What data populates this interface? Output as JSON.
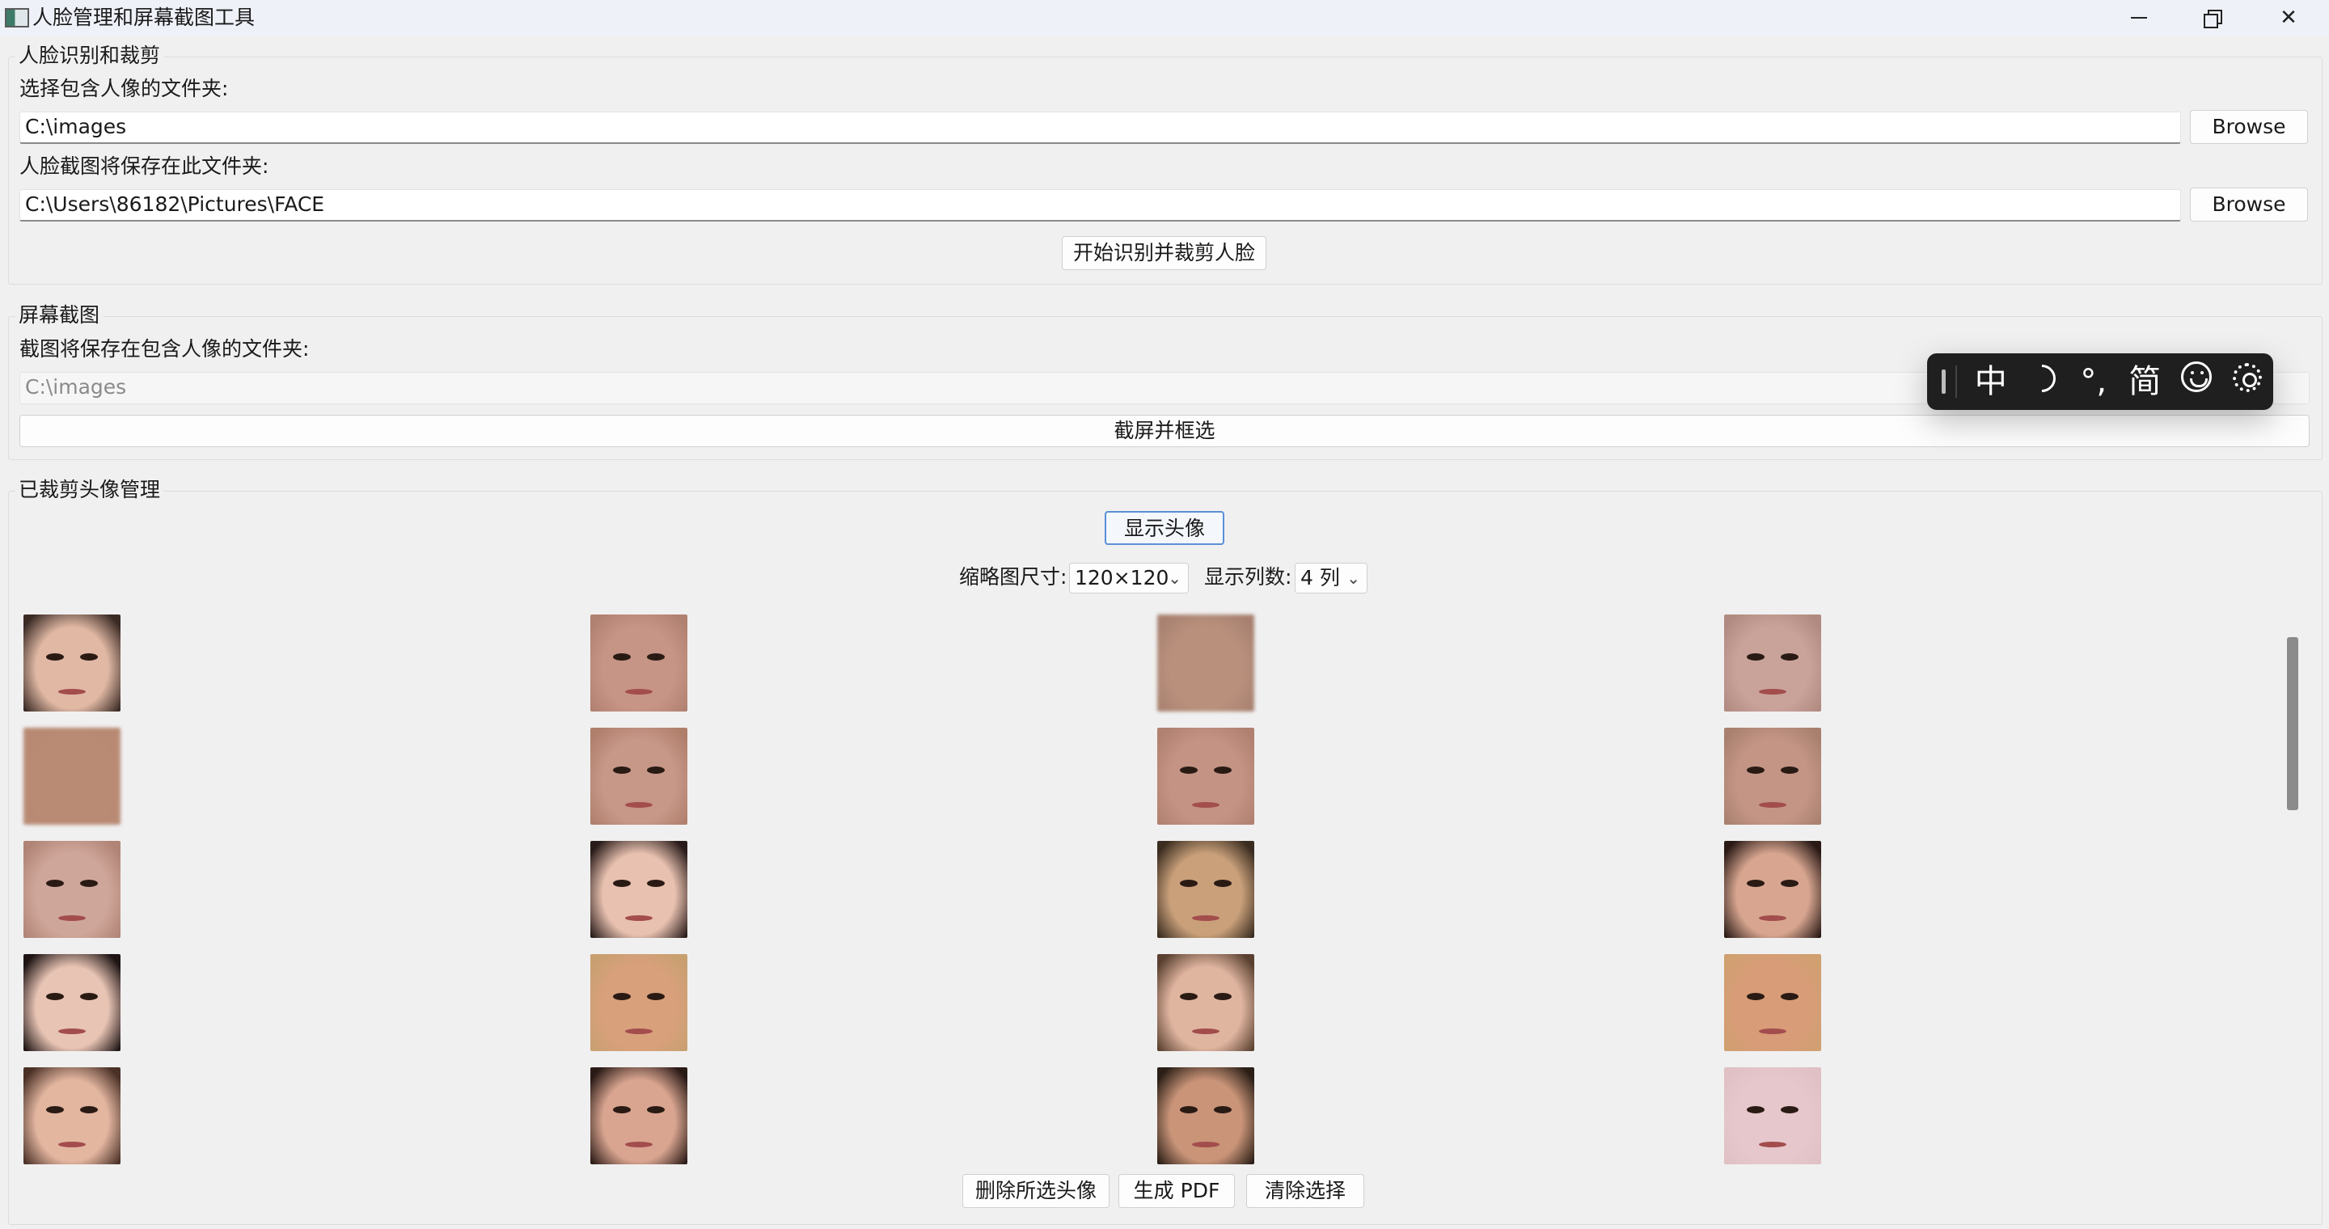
{
  "window": {
    "title": "人脸管理和屏幕截图工具",
    "min_icon": "minimize-icon",
    "max_icon": "restore-icon",
    "close_icon": "close-icon",
    "close_glyph": "✕"
  },
  "face_group": {
    "title": "人脸识别和裁剪",
    "source_label": "选择包含人像的文件夹:",
    "source_value": "C:\\images",
    "source_browse": "Browse",
    "dest_label": "人脸截图将保存在此文件夹:",
    "dest_value": "C:\\Users\\86182\\Pictures\\FACE",
    "dest_browse": "Browse",
    "start_button": "开始识别并裁剪人脸"
  },
  "screenshot_group": {
    "title": "屏幕截图",
    "save_label": "截图将保存在包含人像的文件夹:",
    "save_value": "C:\\images",
    "capture_button": "截屏并框选"
  },
  "manager_group": {
    "title": "已裁剪头像管理",
    "show_button": "显示头像",
    "thumb_size_label": "缩略图尺寸:",
    "thumb_size_value": "120×120",
    "columns_label": "显示列数:",
    "columns_value": "4 列",
    "delete_button": "删除所选头像",
    "pdf_button": "生成 PDF",
    "clear_button": "清除选择"
  },
  "thumbnails": [
    {
      "bg": "#3a2a24",
      "skin": "#e0b8a4",
      "blur": false
    },
    {
      "bg": "#b08070",
      "skin": "#c79585",
      "blur": false
    },
    {
      "bg": "#a88070",
      "skin": "#b8907c",
      "blur": true
    },
    {
      "bg": "#b08a80",
      "skin": "#c9a39a",
      "blur": false
    },
    {
      "bg": "#b88a74",
      "skin": "#b98a74",
      "blur": true
    },
    {
      "bg": "#b07f6c",
      "skin": "#c79788",
      "blur": false
    },
    {
      "bg": "#b08070",
      "skin": "#c49383",
      "blur": false
    },
    {
      "bg": "#a8806e",
      "skin": "#c49585",
      "blur": false
    },
    {
      "bg": "#b08476",
      "skin": "#cfa79a",
      "blur": false
    },
    {
      "bg": "#2a1c1a",
      "skin": "#e8c1b0",
      "blur": false
    },
    {
      "bg": "#3a2c20",
      "skin": "#c9a07a",
      "blur": false
    },
    {
      "bg": "#2a1a16",
      "skin": "#d8a690",
      "blur": false
    },
    {
      "bg": "#1e1414",
      "skin": "#e8c4b4",
      "blur": false
    },
    {
      "bg": "#c8a070",
      "skin": "#d9a07c",
      "blur": false
    },
    {
      "bg": "#5a4030",
      "skin": "#e0b5a0",
      "blur": false
    },
    {
      "bg": "#d0a070",
      "skin": "#d89c78",
      "blur": false
    },
    {
      "bg": "#4a3026",
      "skin": "#e3b6a0",
      "blur": false
    },
    {
      "bg": "#2a1a16",
      "skin": "#d9a590",
      "blur": false
    },
    {
      "bg": "#2a1e16",
      "skin": "#c99478",
      "blur": false
    },
    {
      "bg": "#e0c0c4",
      "skin": "#e6c8cc",
      "blur": false
    }
  ],
  "ime_toolbar": {
    "mode": "中",
    "punct": "°,",
    "script": "简",
    "moon_icon": "moon-icon",
    "emoji_icon": "emoji-icon",
    "settings_icon": "gear-icon"
  }
}
